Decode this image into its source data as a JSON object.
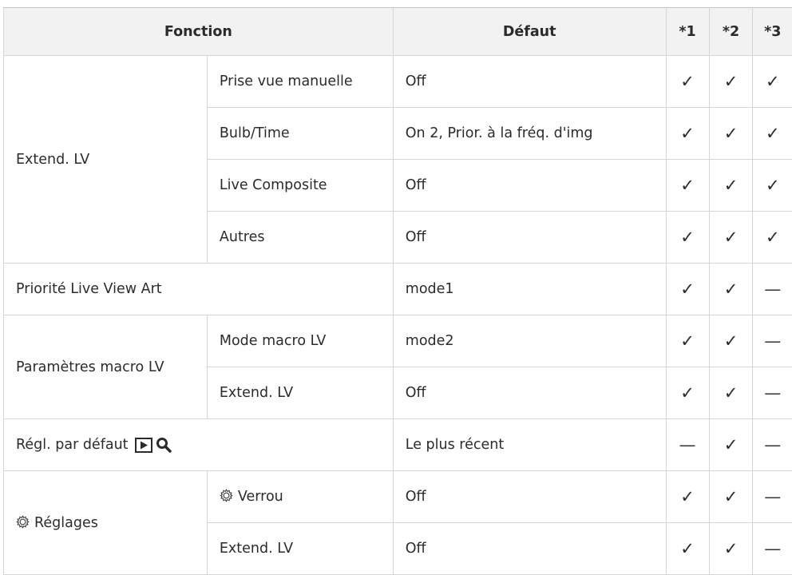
{
  "header": {
    "fonction": "Fonction",
    "defaut": "Défaut",
    "c1": "*1",
    "c2": "*2",
    "c3": "*3"
  },
  "rows": [
    {
      "group": "Extend. LV",
      "sub": "Prise vue manuelle",
      "default": "Off",
      "m1": "✓",
      "m2": "✓",
      "m3": "✓"
    },
    {
      "sub": "Bulb/Time",
      "default": "On 2, Prior. à la fréq. d'img",
      "m1": "✓",
      "m2": "✓",
      "m3": "✓"
    },
    {
      "sub": "Live Composite",
      "default": "Off",
      "m1": "✓",
      "m2": "✓",
      "m3": "✓"
    },
    {
      "sub": "Autres",
      "default": "Off",
      "m1": "✓",
      "m2": "✓",
      "m3": "✓"
    },
    {
      "group": "Priorité Live View Art",
      "default": "mode1",
      "m1": "✓",
      "m2": "✓",
      "m3": "—"
    },
    {
      "group": "Paramètres macro LV",
      "sub": "Mode macro LV",
      "default": "mode2",
      "m1": "✓",
      "m2": "✓",
      "m3": "—"
    },
    {
      "sub": "Extend. LV",
      "default": "Off",
      "m1": "✓",
      "m2": "✓",
      "m3": "—"
    },
    {
      "group": "Régl. par défaut",
      "default": "Le plus récent",
      "m1": "—",
      "m2": "✓",
      "m3": "—"
    },
    {
      "group": "Réglages",
      "sub": "Verrou",
      "default": "Off",
      "m1": "✓",
      "m2": "✓",
      "m3": "—"
    },
    {
      "sub": "Extend. LV",
      "default": "Off",
      "m1": "✓",
      "m2": "✓",
      "m3": "—"
    }
  ],
  "icons": {
    "gear": "gear-icon",
    "play": "play-icon",
    "magnify": "magnify-icon"
  }
}
